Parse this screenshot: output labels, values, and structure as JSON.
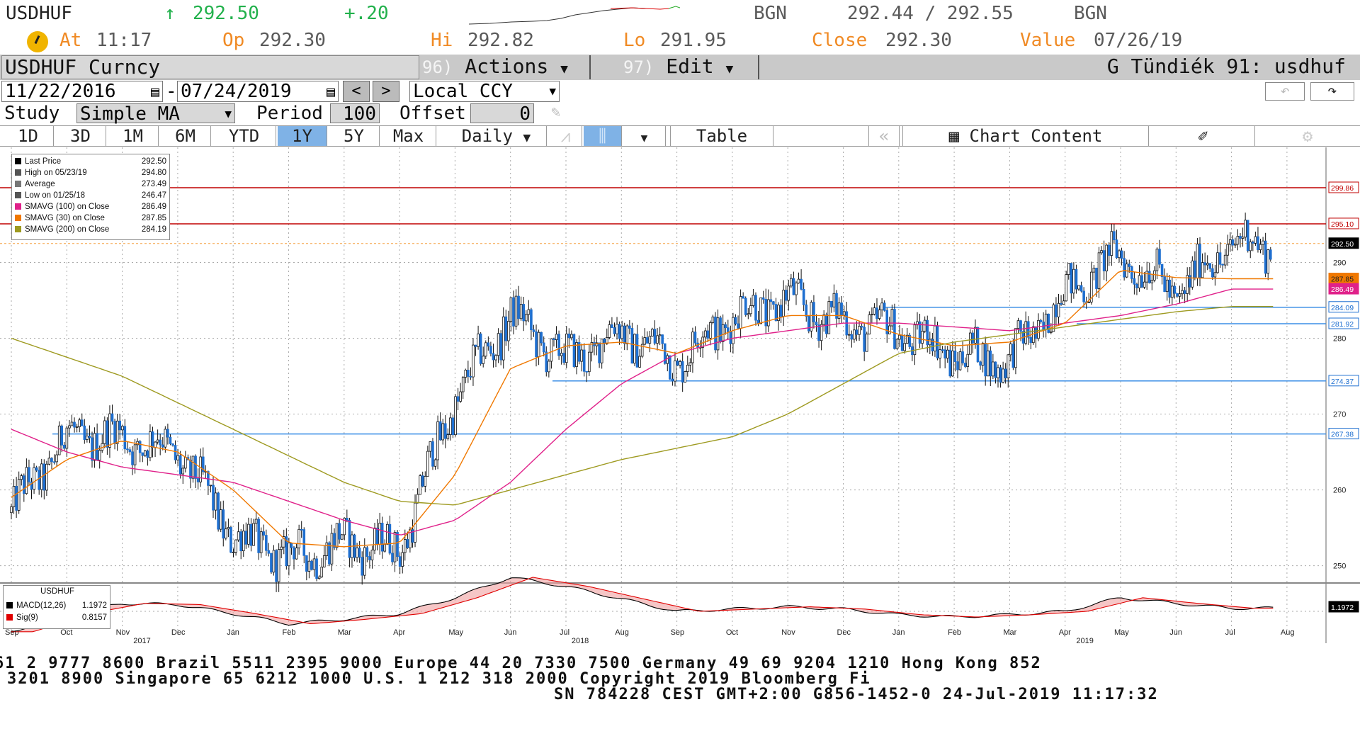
{
  "ticker": {
    "symbol": "USDHUF",
    "last_price": "292.50",
    "change": "+.20",
    "source_left": "BGN",
    "bid_ask": "292.44 / 292.55",
    "source_right": "BGN"
  },
  "quote_line": {
    "at_label": "At",
    "at_value": "11:17",
    "op_label": "Op",
    "op_value": "292.30",
    "hi_label": "Hi",
    "hi_value": "292.82",
    "lo_label": "Lo",
    "lo_value": "291.95",
    "close_label": "Close",
    "close_value": "292.30",
    "value_label": "Value",
    "value_value": "07/26/19"
  },
  "title_bar": {
    "security": "USDHUF Curncy",
    "actions_num": "96)",
    "actions_label": "Actions",
    "edit_num": "97)",
    "edit_label": "Edit",
    "user_label": "G Tündiék 91: usdhuf"
  },
  "date_range": {
    "start": "11/22/2016",
    "end": "07/24/2019",
    "currency": "Local CCY"
  },
  "study": {
    "study_label": "Study",
    "study_value": "Simple MA",
    "period_label": "Period",
    "period_value": "100",
    "offset_label": "Offset",
    "offset_value": "0"
  },
  "period_tabs": [
    "1D",
    "3D",
    "1M",
    "6M",
    "YTD",
    "1Y",
    "5Y",
    "Max"
  ],
  "selected_tab": "1Y",
  "frequency": "Daily",
  "table_label": "Table",
  "chart_content_label": "Chart Content",
  "legend": [
    {
      "label": "Last Price",
      "value": "292.50",
      "color": "#000000"
    },
    {
      "label": "High on 05/23/19",
      "value": "294.80",
      "color": "#555555"
    },
    {
      "label": "Average",
      "value": "273.49",
      "color": "#777777"
    },
    {
      "label": "Low on 01/25/18",
      "value": "246.47",
      "color": "#555555"
    },
    {
      "label": "SMAVG (100)  on Close",
      "value": "286.49",
      "color": "#e0218a"
    },
    {
      "label": "SMAVG (30)  on Close",
      "value": "287.85",
      "color": "#f07800"
    },
    {
      "label": "SMAVG (200)  on Close",
      "value": "284.19",
      "color": "#9e9a20"
    }
  ],
  "macd_legend": {
    "title": "USDHUF",
    "macd_label": "MACD(12,26)",
    "macd_value": "1.1972",
    "sig_label": "Sig(9)",
    "sig_value": "0.8157"
  },
  "footer": {
    "line1": "61 2 9777 8600 Brazil 5511 2395 9000 Europe 44 20 7330 7500 Germany 49 69 9204 1210 Hong Kong 852",
    "line2": "3201 8900         Singapore 65 6212 1000        U.S. 1 212 318 2000        Copyright 2019 Bloomberg Fi",
    "line3": "SN 784228 CEST GMT+2:00 G856-1452-0 24-Jul-2019 11:17:32"
  },
  "colors": {
    "candle": "#1e6fd0",
    "sma100": "#e0218a",
    "sma30": "#f07800",
    "sma200": "#9e9a20",
    "hline_blue": "#3a8ee6",
    "hline_red": "#c00000",
    "last_orange": "#f5a040"
  },
  "chart_data": {
    "type": "line",
    "title": "USDHUF Curncy",
    "ylim": [
      248,
      305
    ],
    "y_ticks": [
      250,
      260,
      270,
      280,
      290
    ],
    "x_labels": [
      "Sep",
      "Oct",
      "Nov",
      "Dec",
      "Jan",
      "Feb",
      "Mar",
      "Apr",
      "May",
      "Jun",
      "Jul",
      "Aug",
      "Sep",
      "Oct",
      "Nov",
      "Dec",
      "Jan",
      "Feb",
      "Mar",
      "Apr",
      "May",
      "Jun",
      "Jul",
      "Aug"
    ],
    "year_labels": [
      "2017",
      "2018",
      "2019"
    ],
    "series": [
      {
        "name": "Last Price",
        "x": [
          "2017-09",
          "2017-10",
          "2017-11",
          "2017-12",
          "2018-01",
          "2018-02",
          "2018-03",
          "2018-04",
          "2018-05",
          "2018-06",
          "2018-07",
          "2018-08",
          "2018-09",
          "2018-10",
          "2018-11",
          "2018-12",
          "2019-01",
          "2019-02",
          "2019-03",
          "2019-04",
          "2019-05",
          "2019-06",
          "2019-07"
        ],
        "values": [
          257,
          267,
          267,
          265,
          254,
          251,
          253,
          252,
          272,
          283,
          277,
          281,
          277,
          283,
          285,
          282,
          281,
          278,
          277,
          286,
          291,
          286,
          292.5
        ]
      },
      {
        "name": "SMAVG (100) on Close",
        "x": [
          "2017-09",
          "2017-10",
          "2017-11",
          "2017-12",
          "2018-01",
          "2018-02",
          "2018-03",
          "2018-04",
          "2018-05",
          "2018-06",
          "2018-07",
          "2018-08",
          "2018-09",
          "2018-10",
          "2018-11",
          "2018-12",
          "2019-01",
          "2019-02",
          "2019-03",
          "2019-04",
          "2019-05",
          "2019-06",
          "2019-07"
        ],
        "values": [
          268,
          265,
          263,
          262,
          261,
          258.5,
          256,
          254,
          256,
          261,
          268,
          274,
          278,
          280,
          281,
          282,
          282,
          281.5,
          281,
          282,
          283,
          284.5,
          286.49
        ]
      },
      {
        "name": "SMAVG (30) on Close",
        "x": [
          "2017-09",
          "2017-10",
          "2017-11",
          "2017-12",
          "2018-01",
          "2018-02",
          "2018-03",
          "2018-04",
          "2018-05",
          "2018-06",
          "2018-07",
          "2018-08",
          "2018-09",
          "2018-10",
          "2018-11",
          "2018-12",
          "2019-01",
          "2019-02",
          "2019-03",
          "2019-04",
          "2019-05",
          "2019-06",
          "2019-07"
        ],
        "values": [
          259,
          264,
          266.5,
          265,
          260,
          253,
          252.5,
          253,
          262,
          276,
          279,
          279.5,
          278,
          281,
          283,
          283,
          280.5,
          279,
          279.5,
          282,
          289,
          288,
          287.85
        ]
      },
      {
        "name": "SMAVG (200) on Close",
        "x": [
          "2017-09",
          "2017-10",
          "2017-11",
          "2017-12",
          "2018-01",
          "2018-02",
          "2018-03",
          "2018-04",
          "2018-05",
          "2018-06",
          "2018-07",
          "2018-08",
          "2018-09",
          "2018-10",
          "2018-11",
          "2018-12",
          "2019-01",
          "2019-02",
          "2019-03",
          "2019-04",
          "2019-05",
          "2019-06",
          "2019-07"
        ],
        "values": [
          280,
          277.5,
          275,
          271.5,
          268,
          264.5,
          261,
          258.5,
          258,
          260,
          262,
          264,
          265.5,
          267,
          270,
          274,
          278,
          279.5,
          280.5,
          281.5,
          282.5,
          283.5,
          284.19
        ]
      }
    ],
    "reference_lines": [
      {
        "value": 299.86,
        "color": "#c00000"
      },
      {
        "value": 295.1,
        "color": "#c00000"
      },
      {
        "value": 284.09,
        "color": "#3a8ee6"
      },
      {
        "value": 281.92,
        "color": "#3a8ee6"
      },
      {
        "value": 274.37,
        "color": "#3a8ee6"
      },
      {
        "value": 267.38,
        "color": "#3a8ee6"
      }
    ],
    "right_labels": [
      "299.86",
      "295.10",
      "292.50",
      "287.85",
      "286.49",
      "284.09",
      "281.92",
      "274.37",
      "267.38"
    ],
    "macd_value_label": "1.1972",
    "legend_position": "top-left"
  }
}
